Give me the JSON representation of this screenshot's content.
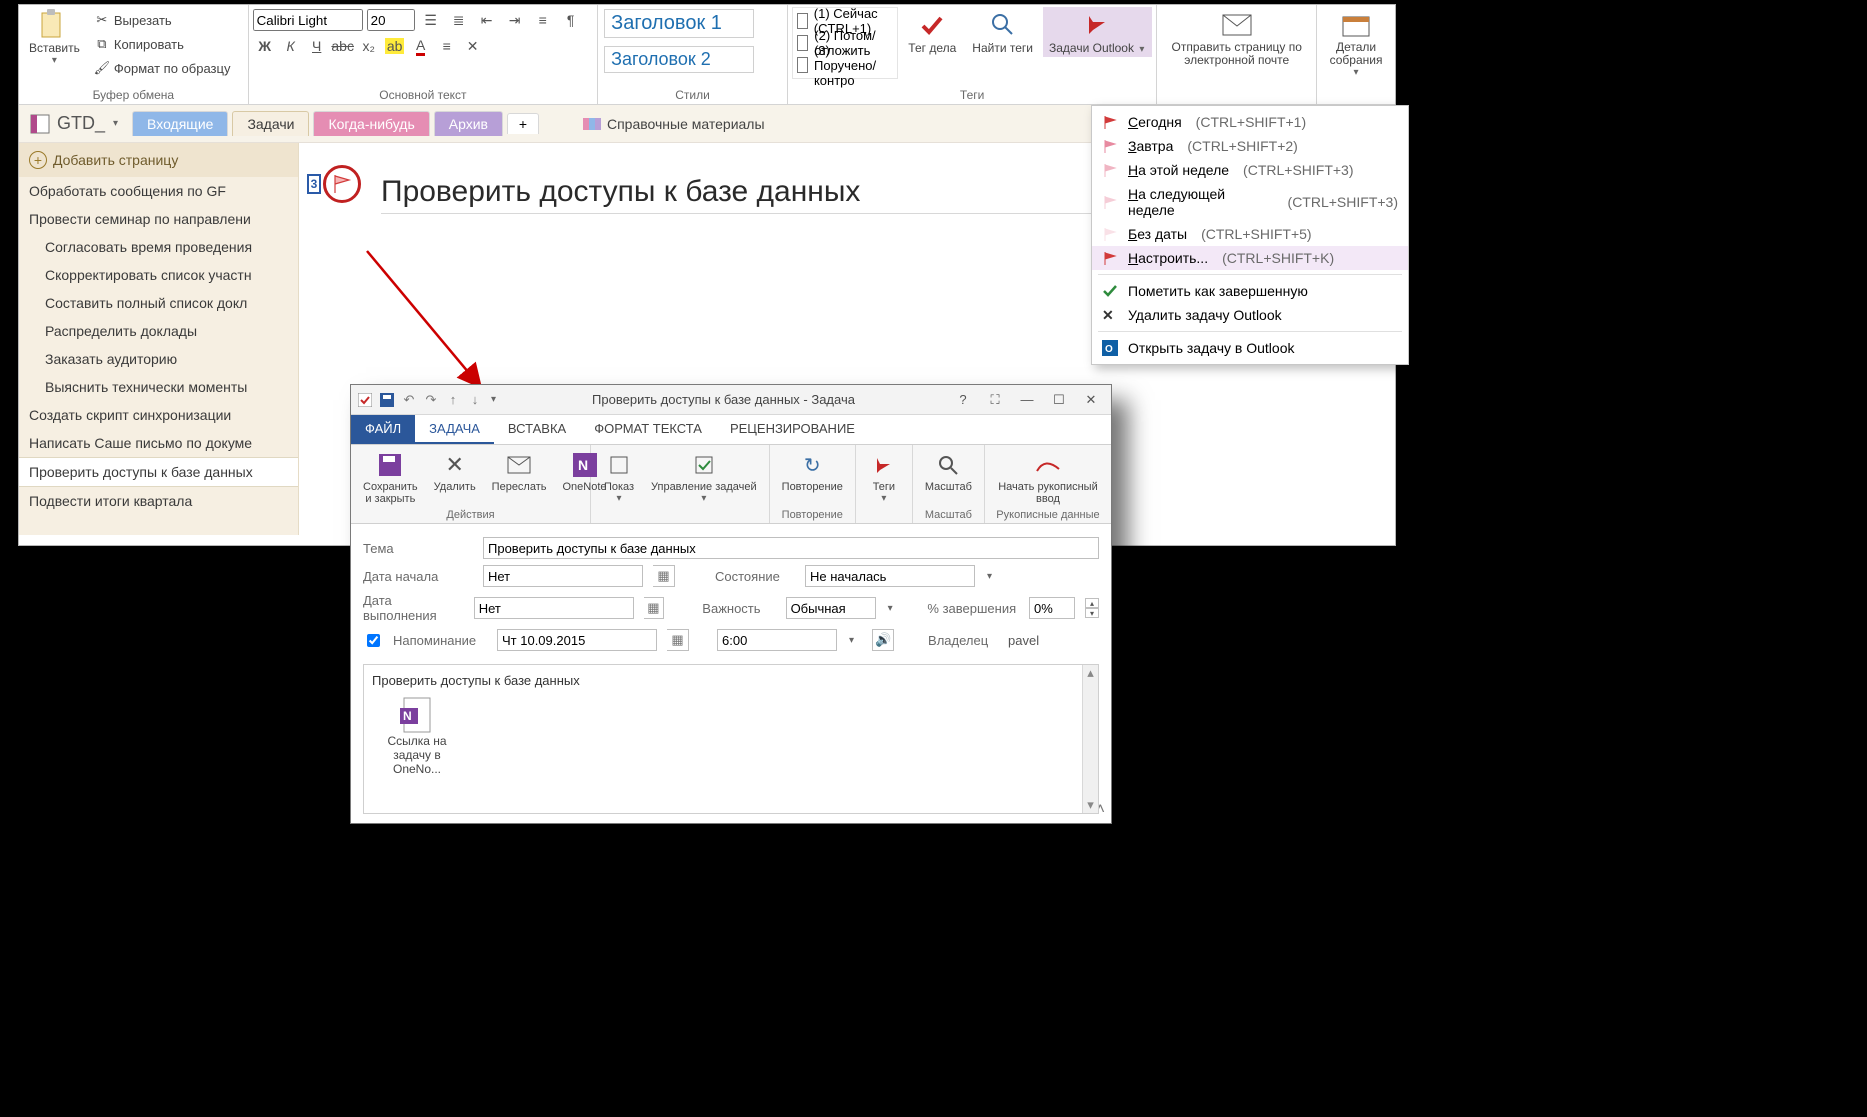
{
  "ribbon": {
    "clipboard": {
      "paste": "Вставить",
      "cut": "Вырезать",
      "copy": "Копировать",
      "format_painter": "Формат по образцу",
      "label": "Буфер обмена"
    },
    "font": {
      "name": "Calibri Light",
      "size": "20",
      "label": "Основной текст"
    },
    "styles": {
      "h1": "Заголовок 1",
      "h2": "Заголовок 2",
      "label": "Стили"
    },
    "tags": {
      "items": [
        "(1) Сейчас (CTRL+1)",
        "(2) Потом/отложить",
        "(3) Поручено/контро"
      ],
      "tag_btn": "Тег дела",
      "find_btn": "Найти теги",
      "outlook_btn": "Задачи Outlook",
      "label": "Теги"
    },
    "email": {
      "label": "Отправить страницу по электронной почте"
    },
    "meeting": {
      "label": "Детали собрания"
    }
  },
  "dropdown": {
    "items": [
      {
        "label": "Сегодня",
        "shortcut": "(CTRL+SHIFT+1)",
        "color": "#d23b3b"
      },
      {
        "label": "Завтра",
        "shortcut": "(CTRL+SHIFT+2)",
        "color": "#e78aa0"
      },
      {
        "label": "На этой неделе",
        "shortcut": "(CTRL+SHIFT+3)",
        "color": "#f0b5c3"
      },
      {
        "label": "На следующей неделе",
        "shortcut": "(CTRL+SHIFT+3)",
        "color": "#f5cdd7"
      },
      {
        "label": "Без даты",
        "shortcut": "(CTRL+SHIFT+5)",
        "color": "#f9e1e7"
      },
      {
        "label": "Настроить...",
        "shortcut": "(CTRL+SHIFT+K)",
        "color": "#d23b3b",
        "sel": true
      }
    ],
    "complete": "Пометить как завершенную",
    "delete": "Удалить задачу Outlook",
    "open": "Открыть задачу в Outlook"
  },
  "notebook": {
    "name": "GTD_"
  },
  "tabs": {
    "inbox": "Входящие",
    "tasks": "Задачи",
    "someday": "Когда-нибудь",
    "archive": "Архив",
    "reference": "Справочные материалы"
  },
  "pages": {
    "add": "Добавить страницу",
    "items": [
      {
        "t": "Обработать сообщения по GF"
      },
      {
        "t": "Провести семинар по направлени"
      },
      {
        "t": "Согласовать время проведения",
        "indent": true
      },
      {
        "t": "Скорректировать список участн",
        "indent": true
      },
      {
        "t": "Составить полный список докл",
        "indent": true
      },
      {
        "t": "Распределить доклады",
        "indent": true
      },
      {
        "t": "Заказать аудиторию",
        "indent": true
      },
      {
        "t": "Выяснить технически моменты",
        "indent": true
      },
      {
        "t": "Создать скрипт синхронизации"
      },
      {
        "t": "Написать Саше письмо по докуме"
      },
      {
        "t": "Проверить доступы к базе данных",
        "selected": true
      },
      {
        "t": "Подвести итоги квартала"
      }
    ]
  },
  "page": {
    "title": "Проверить доступы к базе данных",
    "marker": "3"
  },
  "outlook": {
    "title": "Проверить доступы к базе данных - Задача",
    "tabs": {
      "file": "ФАЙЛ",
      "task": "ЗАДАЧА",
      "insert": "ВСТАВКА",
      "format": "ФОРМАТ ТЕКСТА",
      "review": "РЕЦЕНЗИРОВАНИЕ"
    },
    "ribbon": {
      "save_close": "Сохранить и закрыть",
      "delete": "Удалить",
      "forward": "Переслать",
      "onenote": "OneNote",
      "actions_label": "Действия",
      "show": "Показ",
      "manage": "Управление задачей",
      "recur": "Повторение",
      "recur_label": "Повторение",
      "tags": "Теги",
      "zoom": "Масштаб",
      "zoom_label": "Масштаб",
      "ink": "Начать рукописный ввод",
      "ink_label": "Рукописные данные"
    },
    "form": {
      "subject_label": "Тема",
      "subject": "Проверить доступы к базе данных",
      "start_label": "Дата начала",
      "start": "Нет",
      "due_label": "Дата выполнения",
      "due": "Нет",
      "status_label": "Состояние",
      "status": "Не началась",
      "priority_label": "Важность",
      "priority": "Обычная",
      "percent_label": "% завершения",
      "percent": "0%",
      "reminder_label": "Напоминание",
      "reminder_date": "Чт 10.09.2015",
      "reminder_time": "6:00",
      "owner_label": "Владелец",
      "owner": "pavel"
    },
    "body": {
      "text": "Проверить доступы к базе данных",
      "link": "Ссылка на задачу в OneNo..."
    }
  }
}
